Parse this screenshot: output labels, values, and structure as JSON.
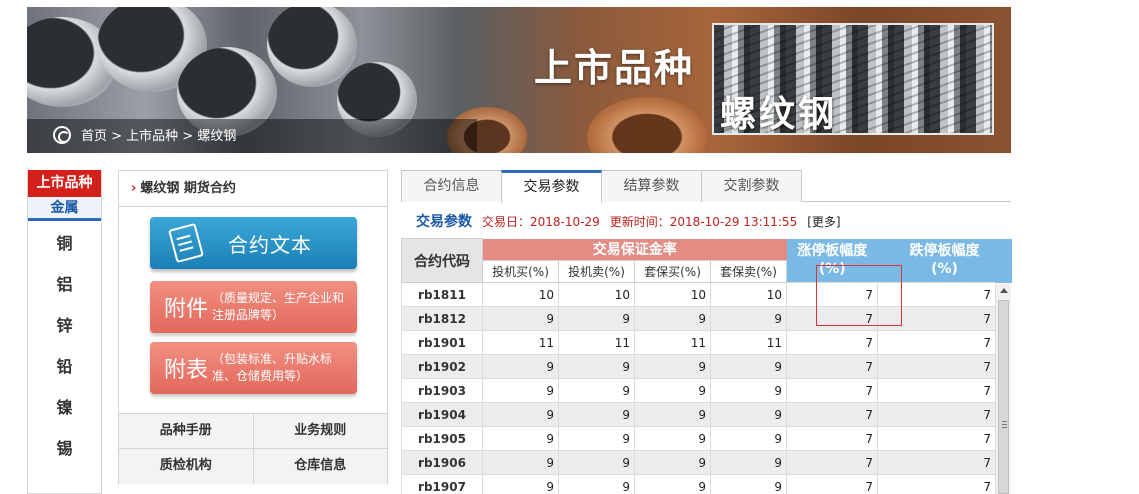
{
  "banner": {
    "title": "上市品种",
    "subtitle": "螺纹钢",
    "breadcrumb": "首页 > 上市品种 > 螺纹钢"
  },
  "left_category": {
    "header": "上市品种",
    "group": "金属",
    "items": [
      "铜",
      "铝",
      "锌",
      "铅",
      "镍",
      "锡"
    ]
  },
  "mid_panel": {
    "title": "螺纹钢 期货合约",
    "contract_button": "合约文本",
    "attachment_button": {
      "big": "附件",
      "small": "（质量规定、生产企业和注册品牌等）"
    },
    "schedule_button": {
      "big": "附表",
      "small": "（包装标准、升贴水标准、仓储费用等）"
    },
    "links": [
      [
        "品种手册",
        "业务规则"
      ],
      [
        "质检机构",
        "仓库信息"
      ]
    ]
  },
  "tabs": [
    "合约信息",
    "交易参数",
    "结算参数",
    "交割参数"
  ],
  "active_tab": 1,
  "info": {
    "title": "交易参数",
    "trade_date": "交易日：2018-10-29",
    "update_time": "更新时间：2018-10-29 13:11:55",
    "more": "[更多]"
  },
  "table": {
    "col_code": "合约代码",
    "group_margin": "交易保证金率",
    "col_up": "涨停板幅度\n(%)",
    "col_down": "跌停板幅度\n(%)",
    "sub_headers": [
      "投机买(%)",
      "投机卖(%)",
      "套保买(%)",
      "套保卖(%)"
    ],
    "rows": [
      [
        "rb1811",
        "10",
        "10",
        "10",
        "10",
        "7",
        "7"
      ],
      [
        "rb1812",
        "9",
        "9",
        "9",
        "9",
        "7",
        "7"
      ],
      [
        "rb1901",
        "11",
        "11",
        "11",
        "11",
        "7",
        "7"
      ],
      [
        "rb1902",
        "9",
        "9",
        "9",
        "9",
        "7",
        "7"
      ],
      [
        "rb1903",
        "9",
        "9",
        "9",
        "9",
        "7",
        "7"
      ],
      [
        "rb1904",
        "9",
        "9",
        "9",
        "9",
        "7",
        "7"
      ],
      [
        "rb1905",
        "9",
        "9",
        "9",
        "9",
        "7",
        "7"
      ],
      [
        "rb1906",
        "9",
        "9",
        "9",
        "9",
        "7",
        "7"
      ],
      [
        "rb1907",
        "9",
        "9",
        "9",
        "9",
        "7",
        "7"
      ]
    ]
  }
}
